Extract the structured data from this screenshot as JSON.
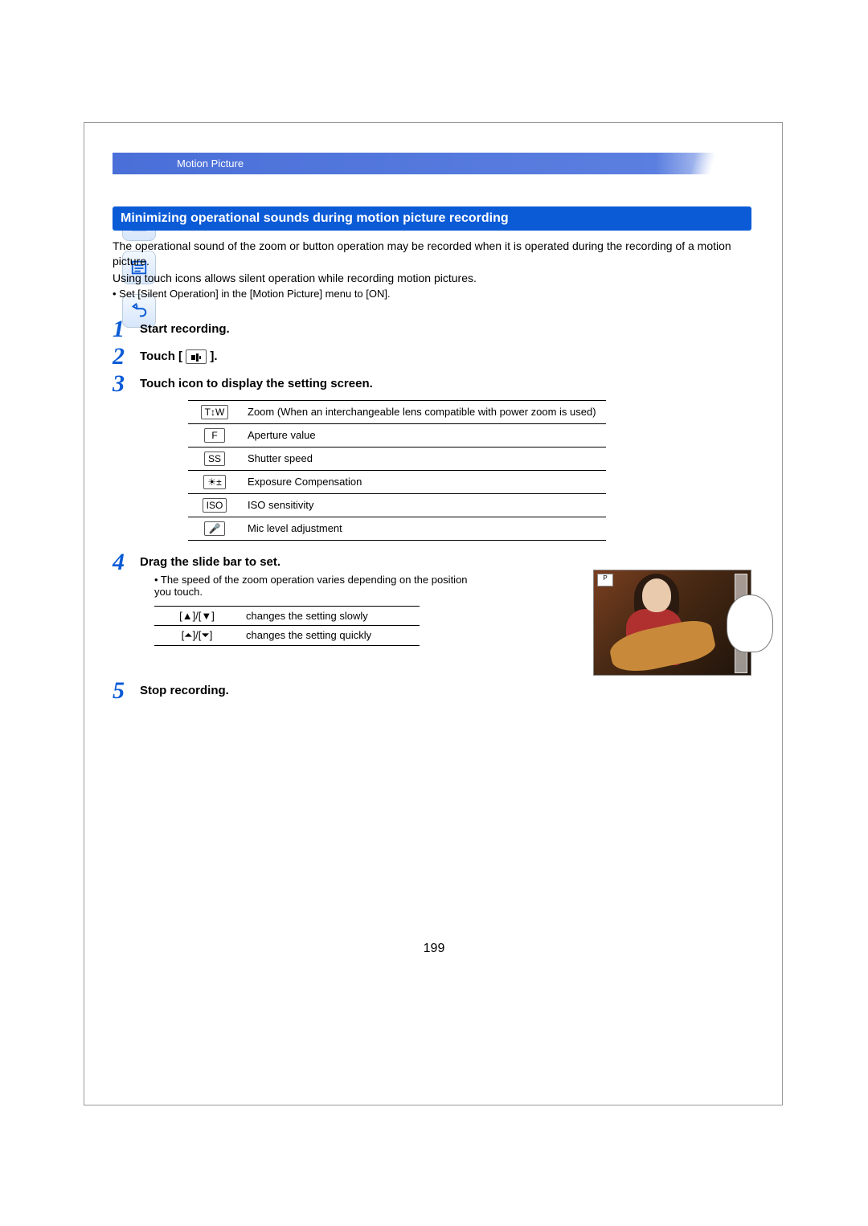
{
  "breadcrumb": "Motion Picture",
  "section_heading": "Minimizing operational sounds during motion picture recording",
  "intro_p1": "The operational sound of the zoom or button operation may be recorded when it is operated during the recording of a motion picture.",
  "intro_p2": "Using touch icons allows silent operation while recording motion pictures.",
  "intro_bullet": "• Set [Silent Operation] in the [Motion Picture] menu to [ON].",
  "steps": {
    "s1": {
      "num": "1",
      "title": "Start recording."
    },
    "s2": {
      "num": "2",
      "title_prefix": "Touch [",
      "title_suffix": " ].",
      "icon_name": "silent-touch-icon"
    },
    "s3": {
      "num": "3",
      "title": "Touch icon to display the setting screen."
    },
    "s4": {
      "num": "4",
      "title": "Drag the slide bar to set.",
      "sub_bullet": "• The speed of the zoom operation varies depending on the position you touch."
    },
    "s5": {
      "num": "5",
      "title": "Stop recording."
    }
  },
  "settings_table": [
    {
      "icon": "T↕W",
      "desc": "Zoom (When an interchangeable lens compatible with power zoom is used)"
    },
    {
      "icon": "F",
      "desc": "Aperture value"
    },
    {
      "icon": "SS",
      "desc": "Shutter speed"
    },
    {
      "icon": "☀±",
      "desc": "Exposure Compensation"
    },
    {
      "icon": "ISO",
      "desc": "ISO sensitivity"
    },
    {
      "icon": "🎤",
      "desc": "Mic level adjustment"
    }
  ],
  "slide_table": [
    {
      "sym": "[▲]/[▼]",
      "desc": "changes the setting slowly"
    },
    {
      "sym": "[⏶]/[⏷]",
      "desc": "changes the setting quickly"
    }
  ],
  "page_number": "199",
  "photo_badge": "P"
}
